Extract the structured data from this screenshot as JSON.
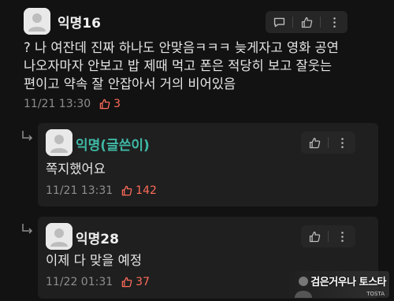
{
  "comments": [
    {
      "username": "익명16",
      "lines": [
        "? 나 여잔데 진짜 하나도 안맞음ㅋㅋㅋ 늦게자고 영화 공연",
        "나오자마자 안보고 밥 제때 먹고 폰은 적당히 보고 잘웃는",
        "편이고 약속 잘 안잡아서 거의 비어있음"
      ],
      "timestamp": "11/21 13:30",
      "likes": "3"
    }
  ],
  "replies": [
    {
      "username": "익명(글쓴이)",
      "text": "쪽지했어요",
      "timestamp": "11/21 13:31",
      "likes": "142"
    },
    {
      "username": "익명28",
      "text": "이제 다 맞을 예정",
      "timestamp": "11/22 01:31",
      "likes": "37"
    }
  ],
  "watermark": {
    "title": "검은거우나 토스타",
    "sub": "TOSTA"
  },
  "colors": {
    "background": "#121212",
    "card": "#1f1f1f",
    "like": "#ff6b5a",
    "author": "#3fb8a6"
  }
}
